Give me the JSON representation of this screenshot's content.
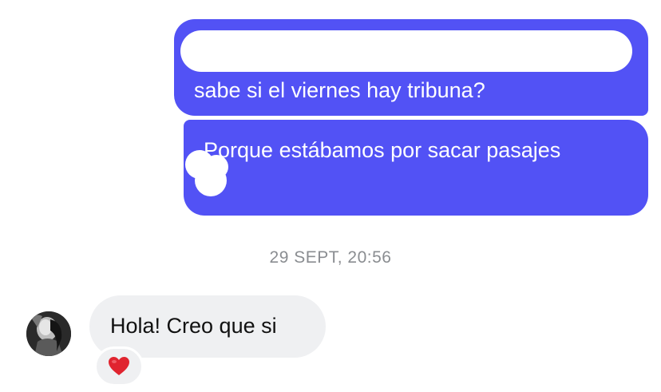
{
  "chat": {
    "outgoing": [
      {
        "text": "sabe si el viernes hay tribuna?"
      },
      {
        "text": "Porque estábamos por sacar pasajes"
      }
    ],
    "timestamp": "29 SEPT, 20:56",
    "incoming": [
      {
        "text": "Hola! Creo que si",
        "reaction": "heart-emoji"
      }
    ]
  },
  "colors": {
    "outgoing_bubble": "#5252f5",
    "incoming_bubble": "#eff0f2",
    "timestamp_text": "#8a8d91",
    "reaction_heart": "#e0242f"
  }
}
